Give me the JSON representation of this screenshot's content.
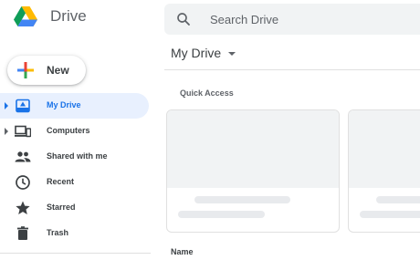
{
  "app": {
    "logo_icon": "google-drive-logo",
    "title": "Drive"
  },
  "search": {
    "placeholder": "Search Drive",
    "icon": "search-icon"
  },
  "new_button": {
    "label": "New",
    "icon": "multicolor-plus-icon"
  },
  "sidebar": {
    "items": [
      {
        "label": "My Drive",
        "icon": "my-drive-icon",
        "active": true,
        "expandable": true
      },
      {
        "label": "Computers",
        "icon": "computers-icon",
        "active": false,
        "expandable": true
      },
      {
        "label": "Shared with me",
        "icon": "shared-people-icon",
        "active": false,
        "expandable": false
      },
      {
        "label": "Recent",
        "icon": "clock-icon",
        "active": false,
        "expandable": false
      },
      {
        "label": "Starred",
        "icon": "star-icon",
        "active": false,
        "expandable": false
      },
      {
        "label": "Trash",
        "icon": "trash-icon",
        "active": false,
        "expandable": false
      }
    ]
  },
  "main": {
    "title": "My Drive",
    "quick_access_label": "Quick Access",
    "name_column_label": "Name"
  },
  "colors": {
    "accent": "#1a73e8",
    "active_bg": "#e8f0fe",
    "search_bg": "#f1f3f4",
    "placeholder_gray": "#e8eaed"
  }
}
